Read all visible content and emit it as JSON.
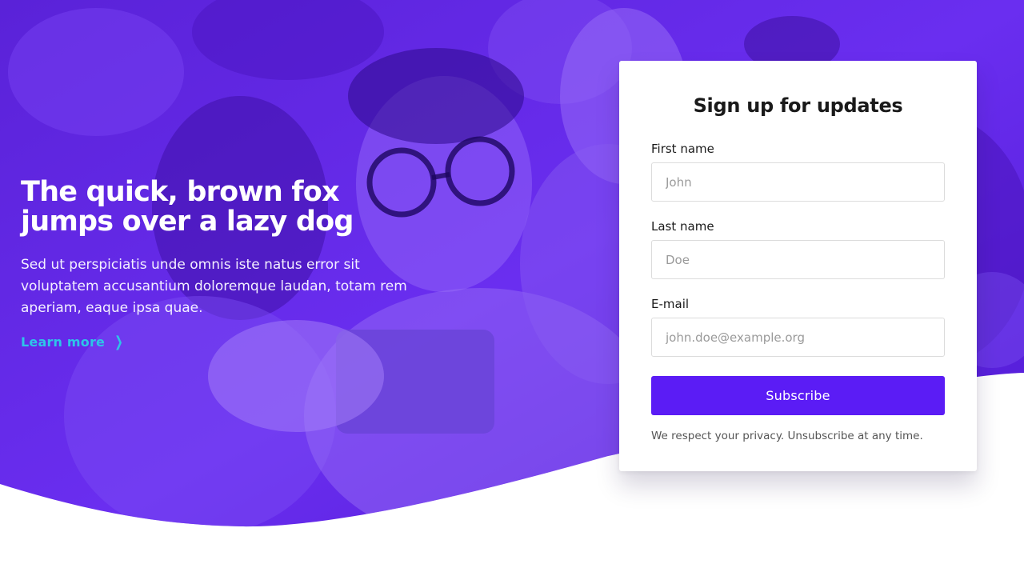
{
  "hero": {
    "title": "The quick, brown fox jumps over a lazy dog",
    "body": "Sed ut perspiciatis unde omnis iste natus error sit voluptatem accusantium doloremque laudan, totam rem aperiam, eaque ipsa quae.",
    "link_label": "Learn more",
    "link_icon": "chevron-right-icon",
    "overlay_color": "#5a1fe0",
    "link_color": "#2ec5e8"
  },
  "form": {
    "title": "Sign up for updates",
    "fields": [
      {
        "label": "First name",
        "placeholder": "John"
      },
      {
        "label": "Last name",
        "placeholder": "Doe"
      },
      {
        "label": "E-mail",
        "placeholder": "john.doe@example.org"
      }
    ],
    "submit_label": "Subscribe",
    "submit_color": "#5b1cf5",
    "privacy_note": "We respect your privacy. Unsubscribe at any time."
  }
}
